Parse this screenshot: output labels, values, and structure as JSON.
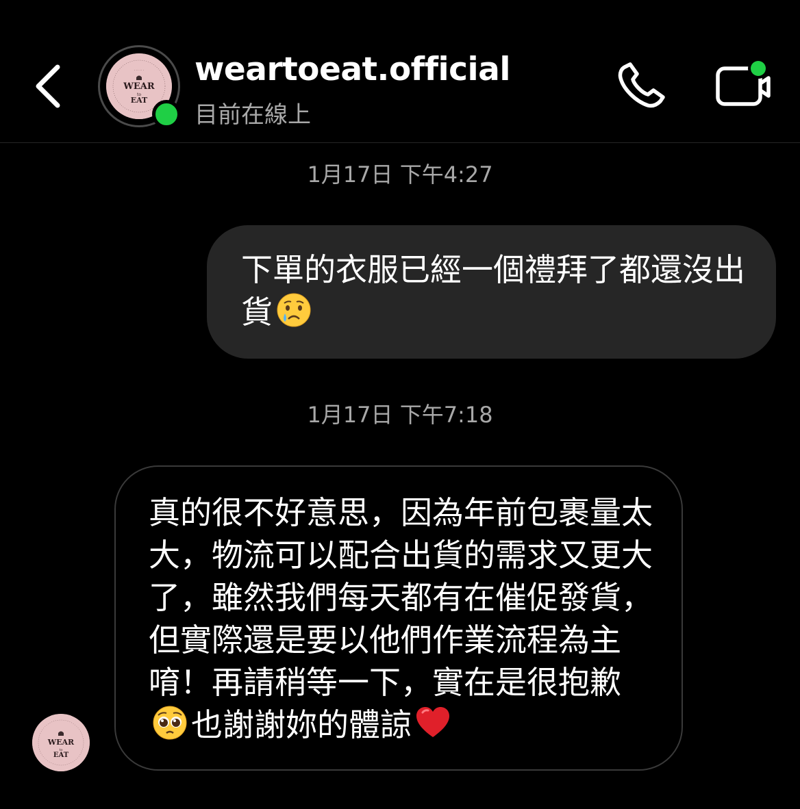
{
  "header": {
    "username": "weartoeat.official",
    "status": "目前在線上",
    "avatar_logo": "WEAR to EAT",
    "icons": {
      "back": "chevron-left-icon",
      "call": "phone-icon",
      "video": "video-camera-icon"
    },
    "online_color": "#1fcf45"
  },
  "messages": [
    {
      "timestamp": "1月17日 下午4:27",
      "direction": "sent",
      "text": "下單的衣服已經一個禮拜了都還沒出貨",
      "trailing_emoji": "crying-face-icon"
    },
    {
      "timestamp": "1月17日 下午7:18",
      "direction": "received",
      "text_part1": "真的很不好意思，因為年前包裹量太大，物流可以配合出貨的需求又更大了，雖然我們每天都有在催促發貨，但實際還是要以他們作業流程為主唷！再請稍等一下，實在是很抱歉",
      "mid_emoji": "pleading-face-icon",
      "text_part2": "也謝謝妳的體諒",
      "trailing_emoji": "red-heart-icon"
    }
  ],
  "colors": {
    "background": "#000000",
    "sent_bubble": "#262626",
    "received_border": "#3a3a3a",
    "muted_text": "#a8a8a8",
    "avatar_bg": "#e8c3c5"
  }
}
